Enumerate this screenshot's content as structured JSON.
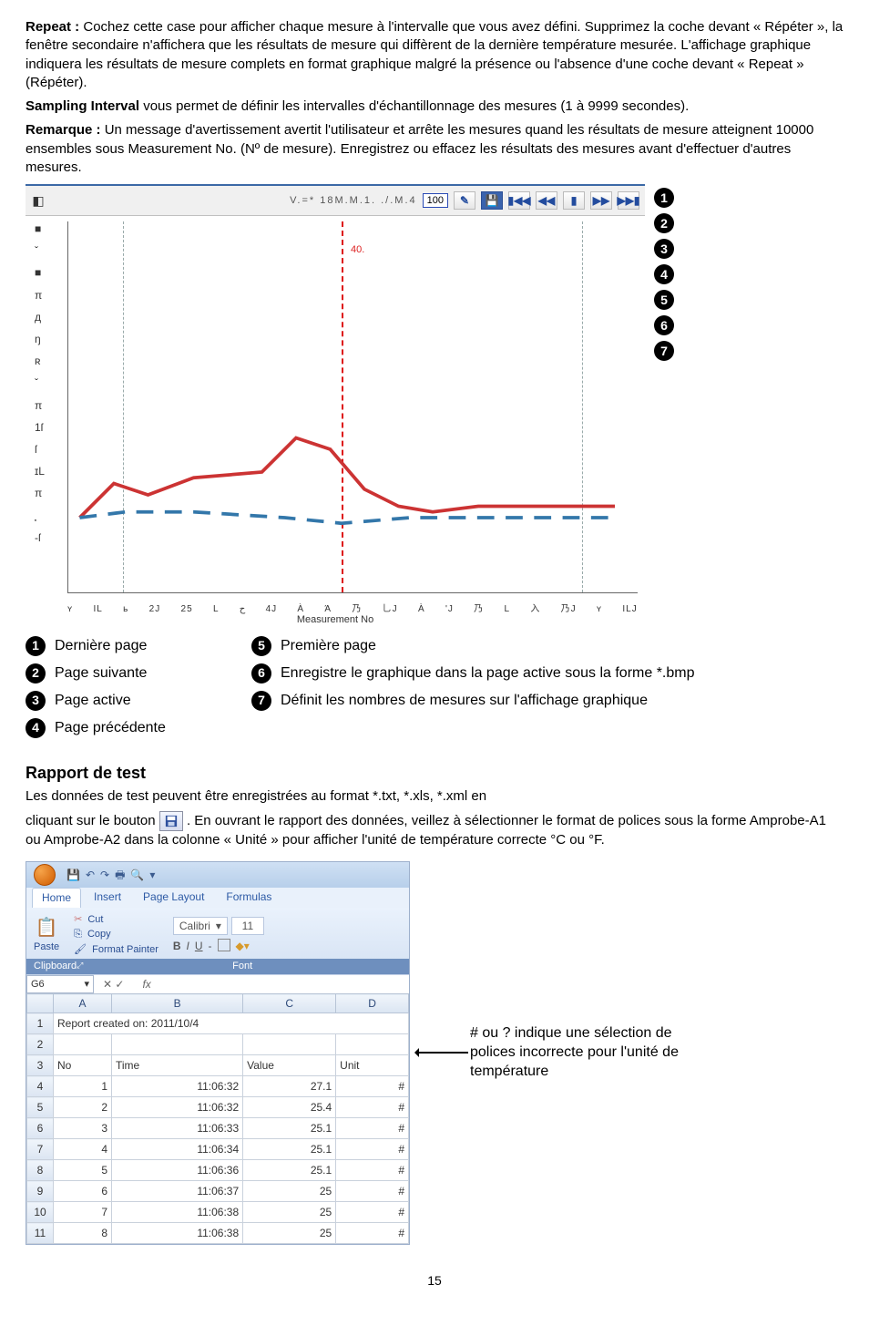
{
  "text": {
    "p1_label": "Repeat :",
    "p1_body": " Cochez cette case pour afficher chaque mesure à l'intervalle que vous avez défini. Supprimez la coche devant « Répéter », la fenêtre secondaire n'affichera que les résultats de mesure qui diffèrent de la dernière température mesurée. L'affichage graphique indiquera les résultats de mesure complets en format graphique malgré la présence ou l'absence d'une coche devant « Repeat » (Répéter).",
    "p2_label": "Sampling Interval",
    "p2_body": " vous permet de définir les intervalles d'échantillonnage des mesures (1 à 9999 secondes).",
    "p3_label": "Remarque :",
    "p3_body": " Un message d'avertissement avertit l'utilisateur et arrête les mesures quand les résultats de mesure atteignent 10000 ensembles sous Measurement No. (Nº de mesure). Enregistrez ou effacez les résultats des mesures avant d'effectuer d'autres mesures.",
    "rapport_title": "Rapport de test",
    "rapport_p1": "Les données de test peuvent être enregistrées au format *.txt, *.xls, *.xml en",
    "rapport_p2_a": "cliquant sur le bouton ",
    "rapport_p2_b": ". En ouvrant le rapport des données, veillez à sélectionner le format de polices sous la forme Amprobe-A1 ou Amprobe-A2 dans la colonne « Unité » pour afficher l'unité de température correcte °C ou °F.",
    "annotation": "# ou ? indique une sélection de polices incorrecte pour l'unité de température",
    "page_num": "15"
  },
  "chart_toolbar": {
    "title_scrawl": "V.=* 18M.M.1.   ./.M.4",
    "num_box": "100",
    "marker_label": "40."
  },
  "chart_data": {
    "type": "line",
    "xlabel": "Measurement No",
    "ylabel": "",
    "y_ticks": [
      "■",
      "ˇ",
      "■",
      "π",
      "д",
      "ŋ",
      "ʀ",
      "ˇ",
      "π",
      "1ſ",
      "ſ",
      "ɪL",
      "π",
      "⸼",
      "-ſ"
    ],
    "x_ticks": [
      "ʏ",
      "IL",
      "ь",
      "2J",
      "25",
      "L",
      "ح",
      "4J",
      "À",
      "Ά",
      "乃",
      "乚J",
      "À",
      "'J",
      "乃",
      "L",
      "入",
      "乃J",
      "ʏ",
      "ILJ"
    ]
  },
  "legend": {
    "l1": "Dernière page",
    "l2": "Page suivante",
    "l3": "Page active",
    "l4": "Page précédente",
    "r5": "Première page",
    "r6": "Enregistre le graphique dans la page active sous la forme *.bmp",
    "r7": "Définit les nombres de mesures sur l'affichage graphique"
  },
  "excel": {
    "tabs": [
      "Home",
      "Insert",
      "Page Layout",
      "Formulas"
    ],
    "cut": "Cut",
    "copy": "Copy",
    "fmt": "Format Painter",
    "font_name": "Calibri",
    "font_size": "11",
    "paste": "Paste",
    "grp_clipboard": "Clipboard",
    "grp_font": "Font",
    "namebox": "G6",
    "cols": [
      "",
      "A",
      "B",
      "C",
      "D"
    ],
    "rows": [
      {
        "r": "1",
        "a": "Report created on: 2011/10/4",
        "span": true
      },
      {
        "r": "2",
        "a": "",
        "b": "",
        "c": "",
        "d": ""
      },
      {
        "r": "3",
        "a": "No",
        "b": "Time",
        "c": "Value",
        "d": "Unit"
      },
      {
        "r": "4",
        "a": "1",
        "b": "11:06:32",
        "c": "27.1",
        "d": "#"
      },
      {
        "r": "5",
        "a": "2",
        "b": "11:06:32",
        "c": "25.4",
        "d": "#"
      },
      {
        "r": "6",
        "a": "3",
        "b": "11:06:33",
        "c": "25.1",
        "d": "#"
      },
      {
        "r": "7",
        "a": "4",
        "b": "11:06:34",
        "c": "25.1",
        "d": "#"
      },
      {
        "r": "8",
        "a": "5",
        "b": "11:06:36",
        "c": "25.1",
        "d": "#"
      },
      {
        "r": "9",
        "a": "6",
        "b": "11:06:37",
        "c": "25",
        "d": "#"
      },
      {
        "r": "10",
        "a": "7",
        "b": "11:06:38",
        "c": "25",
        "d": "#"
      },
      {
        "r": "11",
        "a": "8",
        "b": "11:06:38",
        "c": "25",
        "d": "#"
      }
    ]
  }
}
